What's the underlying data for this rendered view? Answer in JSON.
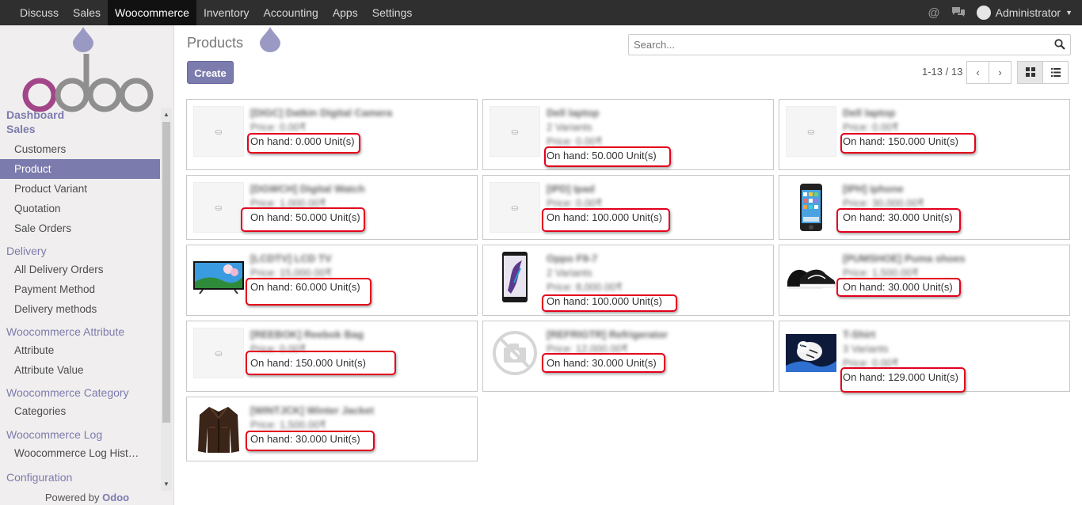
{
  "topbar": {
    "menu": [
      "Discuss",
      "Sales",
      "Woocommerce",
      "Inventory",
      "Accounting",
      "Apps",
      "Settings"
    ],
    "active": "Woocommerce",
    "user": "Administrator"
  },
  "sidebar": {
    "dashboard": "Dashboard",
    "sales": "Sales",
    "sales_items": [
      "Customers",
      "Product",
      "Product Variant",
      "Quotation",
      "Sale Orders"
    ],
    "delivery": "Delivery",
    "delivery_items": [
      "All Delivery Orders",
      "Payment Method",
      "Delivery methods"
    ],
    "attribute_section": "Woocommerce Attribute",
    "attribute_items": [
      "Attribute",
      "Attribute Value"
    ],
    "category_section": "Woocommerce Category",
    "category_items": [
      "Categories"
    ],
    "log_section": "Woocommerce Log",
    "log_items": [
      "Woocommerce Log Hist…"
    ],
    "config_section": "Configuration",
    "powered_by": "Powered by",
    "powered_brand": "Odoo"
  },
  "main": {
    "title": "Products",
    "create_label": "Create",
    "search_placeholder": "Search...",
    "pager": "1-13 / 13"
  },
  "products": [
    {
      "name": "[DIGC] Datkin Digital Camera",
      "lines": [
        "Price: 0.00₹"
      ],
      "onhand": "On hand: 0.000 Unit(s)",
      "image": "placeholder"
    },
    {
      "name": "Dell laptop",
      "lines": [
        "2 Variants",
        "Price: 0.00₹"
      ],
      "onhand": "On hand: 50.000 Unit(s)",
      "image": "placeholder"
    },
    {
      "name": "Dell laptop",
      "lines": [
        "Price: 0.00₹"
      ],
      "onhand": "On hand: 150.000 Unit(s)",
      "image": "placeholder"
    },
    {
      "name": "[DGWCH] Digital Watch",
      "lines": [
        "Price: 1.000.00₹"
      ],
      "onhand": "On hand: 50.000 Unit(s)",
      "image": "placeholder"
    },
    {
      "name": "[IPD] Ipad",
      "lines": [
        "Price: 0.00₹"
      ],
      "onhand": "On hand: 100.000 Unit(s)",
      "image": "placeholder"
    },
    {
      "name": "[IPH] iphone",
      "lines": [
        "Price: 30,000.00₹"
      ],
      "onhand": "On hand: 30.000 Unit(s)",
      "image": "phone"
    },
    {
      "name": "[LCDTV] LCD TV",
      "lines": [
        "Price: 15,000.00₹"
      ],
      "onhand": "On hand: 60.000 Unit(s)",
      "image": "tv"
    },
    {
      "name": "Oppo F9-7",
      "lines": [
        "2 Variants",
        "Price: 8,000.00₹"
      ],
      "onhand": "On hand: 100.000 Unit(s)",
      "image": "smartphone"
    },
    {
      "name": "[PUMSHOE] Puma shoes",
      "lines": [
        "Price: 1,500.00₹"
      ],
      "onhand": "On hand: 30.000 Unit(s)",
      "image": "shoes"
    },
    {
      "name": "[REEBOK] Reebok Bag",
      "lines": [
        "Price: 0.00₹"
      ],
      "onhand": "On hand: 150.000 Unit(s)",
      "image": "placeholder"
    },
    {
      "name": "[REFRIGTR] Refrigerator",
      "lines": [
        "Price: 12,000.00₹"
      ],
      "onhand": "On hand: 30.000 Unit(s)",
      "image": "no-camera"
    },
    {
      "name": "T-Shirt",
      "lines": [
        "3 Variants",
        "Price: 0.00₹"
      ],
      "onhand": "On hand: 129.000 Unit(s)",
      "image": "tiger"
    },
    {
      "name": "[WINTJCK] Winter Jacket",
      "lines": [
        "Price: 1,500.00₹"
      ],
      "onhand": "On hand: 30.000 Unit(s)",
      "image": "jacket"
    }
  ],
  "colors": {
    "accent": "#7c7bad",
    "topbar": "#2f2f2f",
    "highlight": "#e4001c"
  }
}
